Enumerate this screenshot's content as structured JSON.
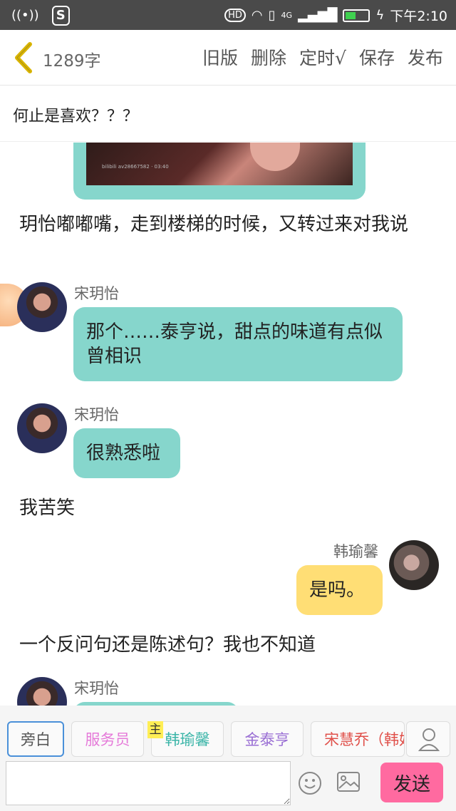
{
  "statusbar": {
    "network_icon": "hotspot-icon",
    "app_icon": "s-app-icon",
    "hd": "HD",
    "net_4g": "4G",
    "time": "下午2:10"
  },
  "header": {
    "wordcount": "1289字",
    "actions": [
      "旧版",
      "删除",
      "定时√",
      "保存",
      "发布"
    ]
  },
  "title": "何止是喜欢？？？",
  "content": {
    "image_caption": "bilibili av28667582 · 03:40",
    "narr1": "玥怡嘟嘟嘴，走到楼梯的时候，又转过来对我说",
    "msg1": {
      "speaker": "宋玥怡",
      "text": "那个……泰亨说，甜点的味道有点似曾相识"
    },
    "msg2": {
      "speaker": "宋玥怡",
      "text": "很熟悉啦"
    },
    "narr2": "我苦笑",
    "msg3": {
      "speaker": "韩瑜馨",
      "text": "是吗。"
    },
    "narr3": "一个反问句还是陈述句？我也不知道",
    "msg4": {
      "speaker": "宋玥怡"
    }
  },
  "roles": [
    {
      "label": "旁白",
      "color": "#555555"
    },
    {
      "label": "服务员",
      "color": "#e57ad9"
    },
    {
      "label": "韩瑜馨",
      "color": "#3bb5a8"
    },
    {
      "label": "金泰亨",
      "color": "#9a6fd4"
    },
    {
      "label": "宋慧乔（韩妃",
      "color": "#e0504a"
    }
  ],
  "main_badge": "主",
  "input": {
    "placeholder": "",
    "send_label": "发送"
  },
  "colors": {
    "bubble_teal": "#86d6cc",
    "bubble_yellow": "#ffde75",
    "send": "#ff6aa0"
  }
}
